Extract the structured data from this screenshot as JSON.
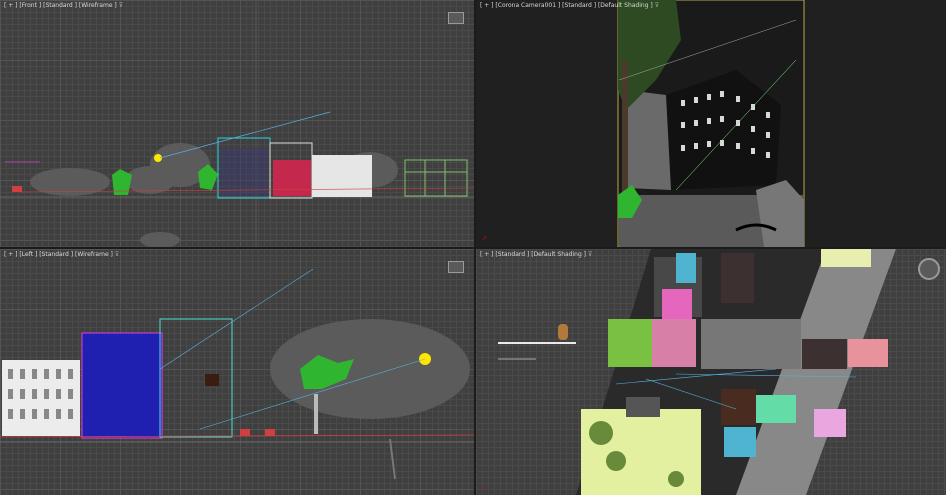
{
  "viewports": {
    "front": {
      "label": "[ + ] [Front ] [Standard ] [Wireframe ]",
      "filter": "⊽"
    },
    "camera": {
      "label": "[ + ] [Corona Camera001 ] [Standard ] [Default Shading ]",
      "filter": "⊽"
    },
    "left": {
      "label": "[ + ] [Left ] [Standard ] [Wireframe ]",
      "filter": "⊽"
    },
    "top": {
      "label": "[ + ] [Standard ] [Default Shading ]",
      "filter": "⊽"
    }
  },
  "colors": {
    "background": "#3f3f3f",
    "grid": "#4a4a4a",
    "active_border": "#b5a84a",
    "tree_green": "#2fb52f"
  }
}
